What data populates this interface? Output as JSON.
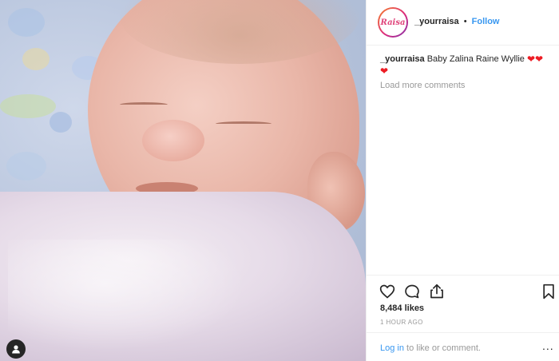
{
  "post": {
    "username": "_yourraisa",
    "separator": "•",
    "follow_label": "Follow",
    "avatar_text": "Raisa"
  },
  "caption": {
    "username": "_yourraisa",
    "text": "Baby Zalina Raine Wyllie",
    "hearts": [
      "❤",
      "❤",
      "❤"
    ]
  },
  "comments": {
    "load_more_label": "Load more comments"
  },
  "actions": {
    "like_icon": "heart-outline-icon",
    "comment_icon": "comment-bubble-icon",
    "share_icon": "share-icon",
    "save_icon": "bookmark-icon"
  },
  "stats": {
    "likes": "8,484 likes",
    "time": "1 HOUR AGO"
  },
  "footer": {
    "login_label": "Log in",
    "rest_text": "to like or comment.",
    "more_label": "..."
  },
  "photo": {
    "description_icon": "user-tag-icon"
  }
}
